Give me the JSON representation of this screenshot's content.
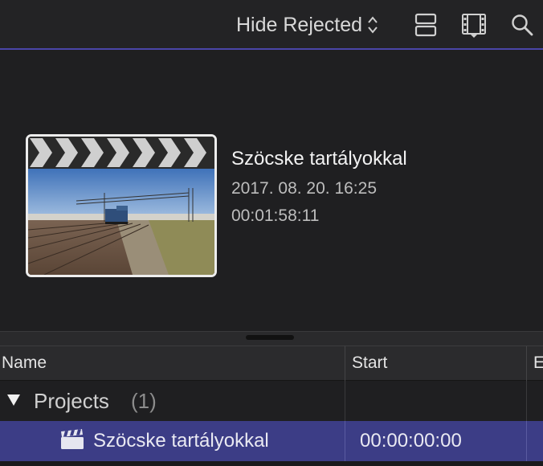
{
  "toolbar": {
    "filter_label": "Hide Rejected",
    "icons": [
      "clip-appearance-icon",
      "filmstrip-icon",
      "search-icon"
    ]
  },
  "clip": {
    "title": "Szöcske tartályokkal",
    "date": "2017. 08. 20. 16:25",
    "duration": "00:01:58:11"
  },
  "list": {
    "columns": [
      "Name",
      "Start",
      "E"
    ],
    "group": {
      "label": "Projects",
      "count": "(1)"
    },
    "rows": [
      {
        "name": "Szöcske tartályokkal",
        "start": "00:00:00:00"
      }
    ]
  },
  "colors": {
    "accent_line": "#4a46a8",
    "selection": "#3c3d86",
    "background": "#1f1f21"
  }
}
